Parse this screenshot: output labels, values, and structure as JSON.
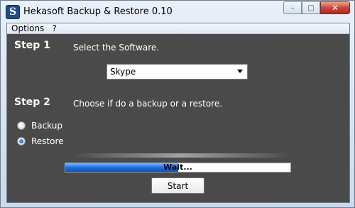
{
  "window": {
    "title": "Hekasoft Backup & Restore 0.10",
    "app_icon_glyph": "S",
    "controls": {
      "minimize": "–",
      "maximize": "□",
      "close": "✕"
    }
  },
  "menu": {
    "items": [
      "Options",
      "?"
    ]
  },
  "step1": {
    "title": "Step 1",
    "description": "Select the Software.",
    "selected_software": "Skype"
  },
  "step2": {
    "title": "Step 2",
    "description": "Choose if do a backup or a restore.",
    "options": [
      {
        "label": "Backup",
        "checked": false
      },
      {
        "label": "Restore",
        "checked": true
      }
    ]
  },
  "progress": {
    "text": "Wait...",
    "fill_fraction": 0.5
  },
  "start_button": {
    "label": "Start"
  },
  "colors": {
    "panel_bg": "#4a4a4a",
    "progress_blue": "#1f6fe0"
  }
}
